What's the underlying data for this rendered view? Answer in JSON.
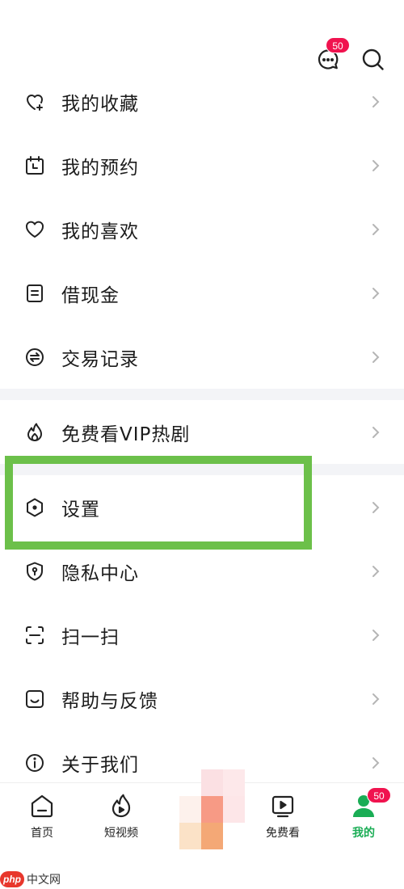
{
  "header": {
    "message_badge": "50",
    "icons": [
      "message-icon",
      "search-icon"
    ]
  },
  "menu": {
    "items": [
      {
        "label": "我的收藏",
        "icon": "favorite-heart-plus-icon"
      },
      {
        "label": "我的预约",
        "icon": "calendar-icon"
      },
      {
        "label": "我的喜欢",
        "icon": "heart-icon"
      },
      {
        "label": "借现金",
        "icon": "document-icon"
      },
      {
        "label": "交易记录",
        "icon": "exchange-icon"
      },
      {
        "label": "免费看VIP热剧",
        "icon": "flame-icon"
      },
      {
        "label": "设置",
        "icon": "settings-hexagon-icon"
      },
      {
        "label": "隐私中心",
        "icon": "privacy-shield-icon"
      },
      {
        "label": "扫一扫",
        "icon": "scan-icon"
      },
      {
        "label": "帮助与反馈",
        "icon": "feedback-icon"
      },
      {
        "label": "关于我们",
        "icon": "info-icon"
      }
    ]
  },
  "tabbar": {
    "tabs": [
      {
        "label": "首页",
        "icon": "home-icon"
      },
      {
        "label": "短视频",
        "icon": "short-video-icon"
      },
      {
        "label": "免费看",
        "icon": "tv-play-icon"
      },
      {
        "label": "我的",
        "icon": "profile-icon"
      }
    ],
    "profile_badge": "50",
    "active_tab": "我的"
  },
  "colors": {
    "accent": "#1aad55",
    "badge": "#f0134f",
    "highlight": "#6cc04a",
    "separator": "#f3f4f7"
  },
  "watermark": {
    "logo": "php",
    "text": "中文网"
  }
}
